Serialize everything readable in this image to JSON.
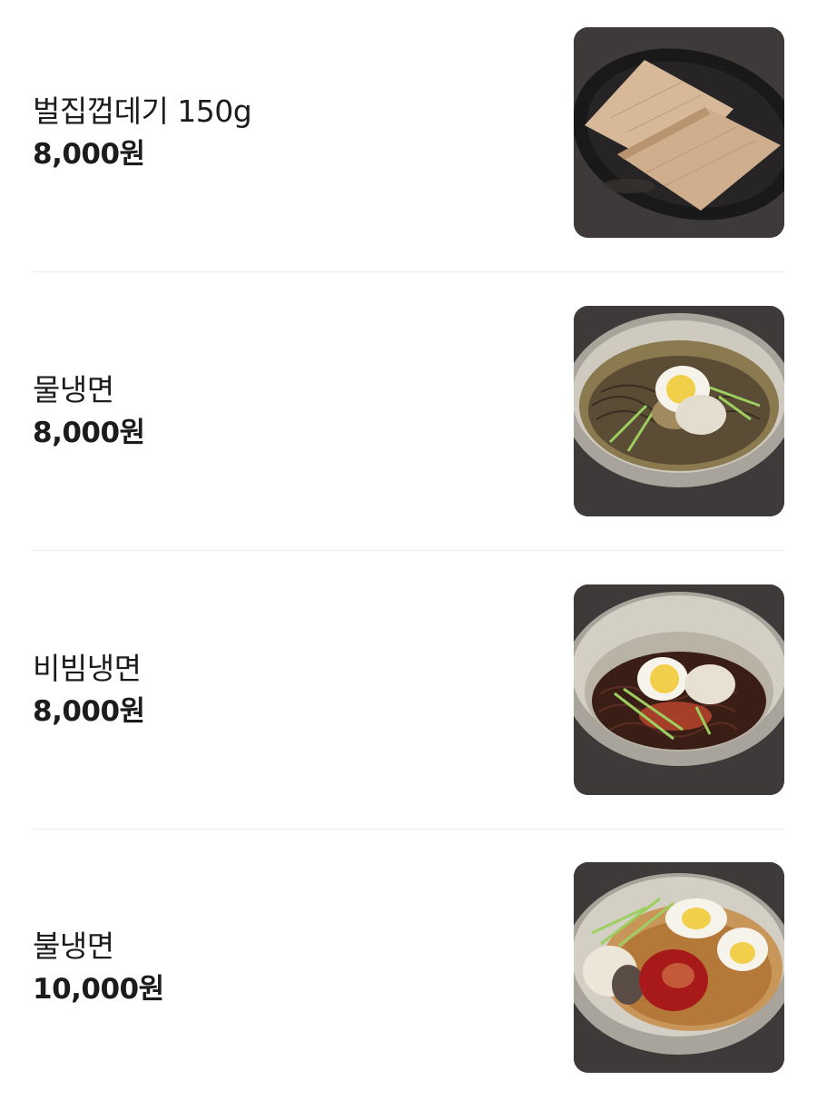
{
  "menu": {
    "items": [
      {
        "name": "벌집껍데기 150g",
        "price": "8,000원",
        "image": "braised-pork-skin-photo"
      },
      {
        "name": "물냉면",
        "price": "8,000원",
        "image": "cold-broth-noodles-photo"
      },
      {
        "name": "비빔냉면",
        "price": "8,000원",
        "image": "spicy-mixed-noodles-photo"
      },
      {
        "name": "불냉면",
        "price": "10,000원",
        "image": "fire-cold-noodles-photo"
      }
    ]
  }
}
